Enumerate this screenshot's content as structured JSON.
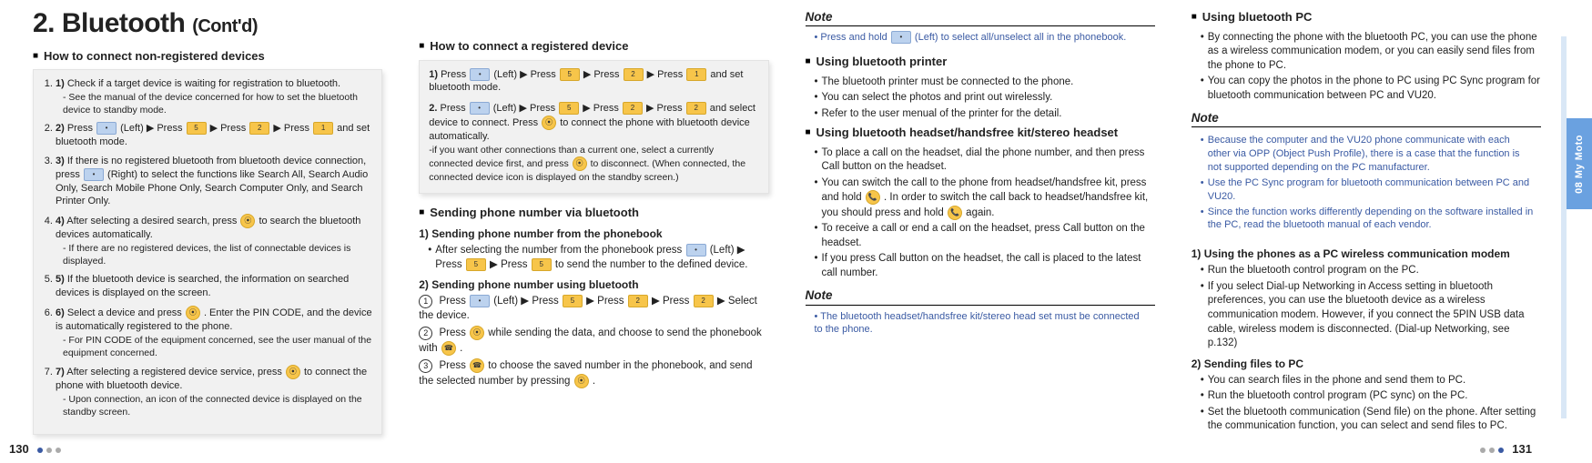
{
  "meta": {
    "title_num": "2.",
    "title_main": "Bluetooth",
    "title_contd": "(Cont'd)",
    "page_left": "130",
    "page_right": "131",
    "sidetab": "08  My Moto"
  },
  "col1": {
    "sec1_title": "How to connect non-registered devices",
    "items": [
      {
        "lead": "Check if a target device is waiting for registration to bluetooth.",
        "sub": "- See the manual of the device concerned for how to set the bluetooth device to standby mode."
      },
      {
        "lead_a": "Press ",
        "lead_b": " (Left) ▶ Press ",
        "lead_c": " ▶ Press ",
        "lead_d": " ▶ Press ",
        "lead_e": " and set bluetooth mode."
      },
      {
        "lead_a": "If there is no registered bluetooth from bluetooth device connection, press ",
        "lead_b": " (Right) to select the functions like Search All, Search Audio Only, Search Mobile Phone Only, Search Computer Only, and Search Printer Only."
      },
      {
        "lead_a": "After selecting a desired search, press ",
        "lead_b": " to search the bluetooth devices automatically.",
        "sub": "- If there are no registered devices, the list of connectable devices is displayed."
      },
      {
        "lead": "If the bluetooth device is searched, the information on searched devices is displayed on the screen."
      },
      {
        "lead_a": "Select a device and press ",
        "lead_b": " . Enter the PIN CODE, and the device is automatically registered to the phone.",
        "sub": "- For PIN CODE of the equipment concerned, see the user manual of the equipment concerned."
      },
      {
        "lead_a": "After selecting a registered device service, press ",
        "lead_b": " to connect the phone with bluetooth device.",
        "sub": "- Upon connection, an icon of the connected device is displayed on the standby screen."
      }
    ]
  },
  "col2": {
    "sec1_title": "How to connect a registered device",
    "box_items": [
      {
        "num": "1)",
        "a": "Press ",
        "b": " (Left) ▶ Press ",
        "c": " ▶ Press ",
        "d": " ▶ Press ",
        "e": " and set bluetooth mode."
      },
      {
        "num": "2.",
        "a": "Press ",
        "b": " (Left) ▶ Press ",
        "c": " ▶ Press ",
        "d": " ▶ Press ",
        "e": " and select device to connect.  Press ",
        "f": " to connect the phone with bluetooth device automatically.",
        "sub": "-if you want other connections than a current one, select a currently connected device first, and press ",
        "sub2": " to disconnect. (When connected, the connected device icon is displayed on the standby screen.)"
      }
    ],
    "sec2_title": "Sending phone number via bluetooth",
    "sub1_title": "1) Sending phone number from the phonebook",
    "sub1_txt_a": "After selecting the number from the phonebook press ",
    "sub1_txt_b": " (Left) ▶ Press ",
    "sub1_txt_c": " ▶ Press ",
    "sub1_txt_d": " to send the number to the defined device.",
    "sub2_title": "2) Sending phone number using bluetooth",
    "sub2_items": [
      {
        "n": "1",
        "a": "Press ",
        "b": " (Left) ▶ Press ",
        "c": " ▶ Press ",
        "d": " ▶ Press ",
        "e": " ▶ Select the device."
      },
      {
        "n": "2",
        "a": "Press ",
        "b": " while sending the data, and choose to send the phonebook with ",
        "c": " ."
      },
      {
        "n": "3",
        "a": "Press ",
        "b": " to choose the saved number in the phonebook, and send the selected number by pressing ",
        "c": " ."
      }
    ]
  },
  "col3": {
    "note1_hdr": "Note",
    "note1_txt_a": "Press and hold ",
    "note1_txt_b": " (Left) to select all/unselect all in the phonebook.",
    "sec1_title": "Using bluetooth printer",
    "sec1_bul": [
      "The bluetooth printer must be connected to the phone.",
      "You can select the photos and print out wirelessly.",
      "Refer to the user menual of the printer for the detail."
    ],
    "sec2_title": "Using bluetooth headset/handsfree kit/stereo headset",
    "sec2_bul": [
      {
        "t": "To place a call on the headset, dial the phone number, and then press Call button on the headset."
      },
      {
        "t1": "You can switch the call to the phone from headset/handsfree kit, press and hold ",
        "t2": ". In order to switch the call back to headset/handsfree kit, you should press and hold ",
        "t3": " again."
      },
      {
        "t": "To receive a call or end a call on the headset, press Call button on the headset."
      },
      {
        "t": "If you press Call button on the headset, the call is placed to the latest call number."
      }
    ],
    "note2_hdr": "Note",
    "note2_txt": "The bluetooth headset/handsfree kit/stereo head set must be connected to the phone."
  },
  "col4": {
    "sec1_title": "Using bluetooth PC",
    "sec1_bul": [
      "By connecting the phone with the bluetooth PC, you can use the phone as a wireless communication modem, or you can easily send files from the phone to PC.",
      "You can copy the photos in the phone to PC using PC Sync program for bluetooth communication between PC and VU20."
    ],
    "note_hdr": "Note",
    "note_bul": [
      "Because the computer and the VU20 phone communicate with each other via OPP (Object Push Profile), there is a case that the function is not supported depending on the PC manufacturer.",
      "Use the PC Sync program for bluetooth communication between PC and VU20.",
      "Since the function works differently depending on the software installed in the PC, read the bluetooth manual of each vendor."
    ],
    "sub1_title": "1) Using the phones as a PC wireless communication modem",
    "sub1_bul": [
      "Run the bluetooth control program on the PC.",
      "If you select Dial-up Networking in Access setting in bluetooth preferences, you can use the bluetooth device as a wireless communication modem. However, if you connect the 5PIN USB data cable, wireless modem is disconnected. (Dial-up Networking, see p.132)"
    ],
    "sub2_title": "2) Sending files to PC",
    "sub2_bul": [
      "You can search files in the phone and send them to PC.",
      "Run the bluetooth control program (PC sync) on the PC.",
      "Set the bluetooth communication (Send file) on the phone. After setting the communication function, you can select and send files to PC."
    ]
  }
}
